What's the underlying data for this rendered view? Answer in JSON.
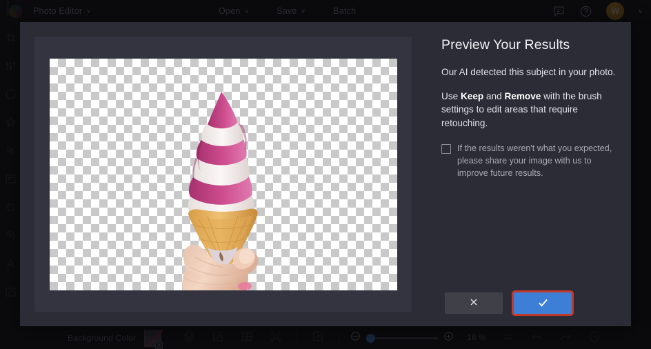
{
  "topbar": {
    "logo_name": "app-logo",
    "app_title": "Photo Editor",
    "caret": "∨",
    "menu": [
      {
        "label": "Open",
        "has_caret": true
      },
      {
        "label": "Save",
        "has_caret": true
      },
      {
        "label": "Batch",
        "has_caret": false
      }
    ],
    "feedback_icon": "comment-icon",
    "help_icon": "help-icon",
    "avatar_initial": "W",
    "avatar_caret": "∨"
  },
  "left_rail": {
    "items": [
      {
        "icon": "crop-icon"
      },
      {
        "icon": "adjust-sliders-icon"
      },
      {
        "icon": "color-wheel-icon"
      },
      {
        "icon": "effects-star-icon"
      },
      {
        "icon": "retouch-icon"
      },
      {
        "icon": "text-frame-icon"
      },
      {
        "icon": "portrait-icon"
      },
      {
        "icon": "sticker-icon"
      },
      {
        "icon": "text-tool-icon"
      },
      {
        "icon": "draw-icon"
      }
    ]
  },
  "modal": {
    "preview": {
      "canvas_name": "image-preview-canvas",
      "transparency_checkerboard": true,
      "subject_description": "Hand holding a pink and white swirl soft-serve ice cream in a waffle cone"
    },
    "title": "Preview Your Results",
    "paragraph_1": "Our AI detected this subject in your photo.",
    "paragraph_2": {
      "prefix": "Use ",
      "bold_1": "Keep",
      "middle": " and ",
      "bold_2": "Remove",
      "suffix": " with the brush settings to edit areas that require retouching."
    },
    "checkbox": {
      "checked": false,
      "label": "If the results weren't what you expected, please share your image with us to improve future results."
    },
    "buttons": {
      "cancel_icon": "close-x-icon",
      "confirm_icon": "checkmark-icon",
      "confirm_highlight_color": "#c0392b",
      "confirm_color": "#3d7fd6"
    }
  },
  "bottombar": {
    "background_color_label": "Background Color",
    "swatch_name": "transparent-swatch",
    "swatch_caret": "∨",
    "tools": [
      {
        "icon": "layers-icon"
      },
      {
        "icon": "transform-icon"
      },
      {
        "icon": "compare-split-icon"
      },
      {
        "icon": "fit-to-screen-icon"
      },
      {
        "icon": "expand-arrow-icon"
      }
    ],
    "zoom_out_icon": "minus-icon",
    "zoom_in_icon": "plus-icon",
    "zoom_value": "18 %",
    "zoom_slider_percent": 0,
    "after_tools": [
      {
        "icon": "loop-compare-icon"
      },
      {
        "icon": "undo-icon"
      },
      {
        "icon": "redo-icon"
      },
      {
        "icon": "history-icon"
      }
    ]
  }
}
